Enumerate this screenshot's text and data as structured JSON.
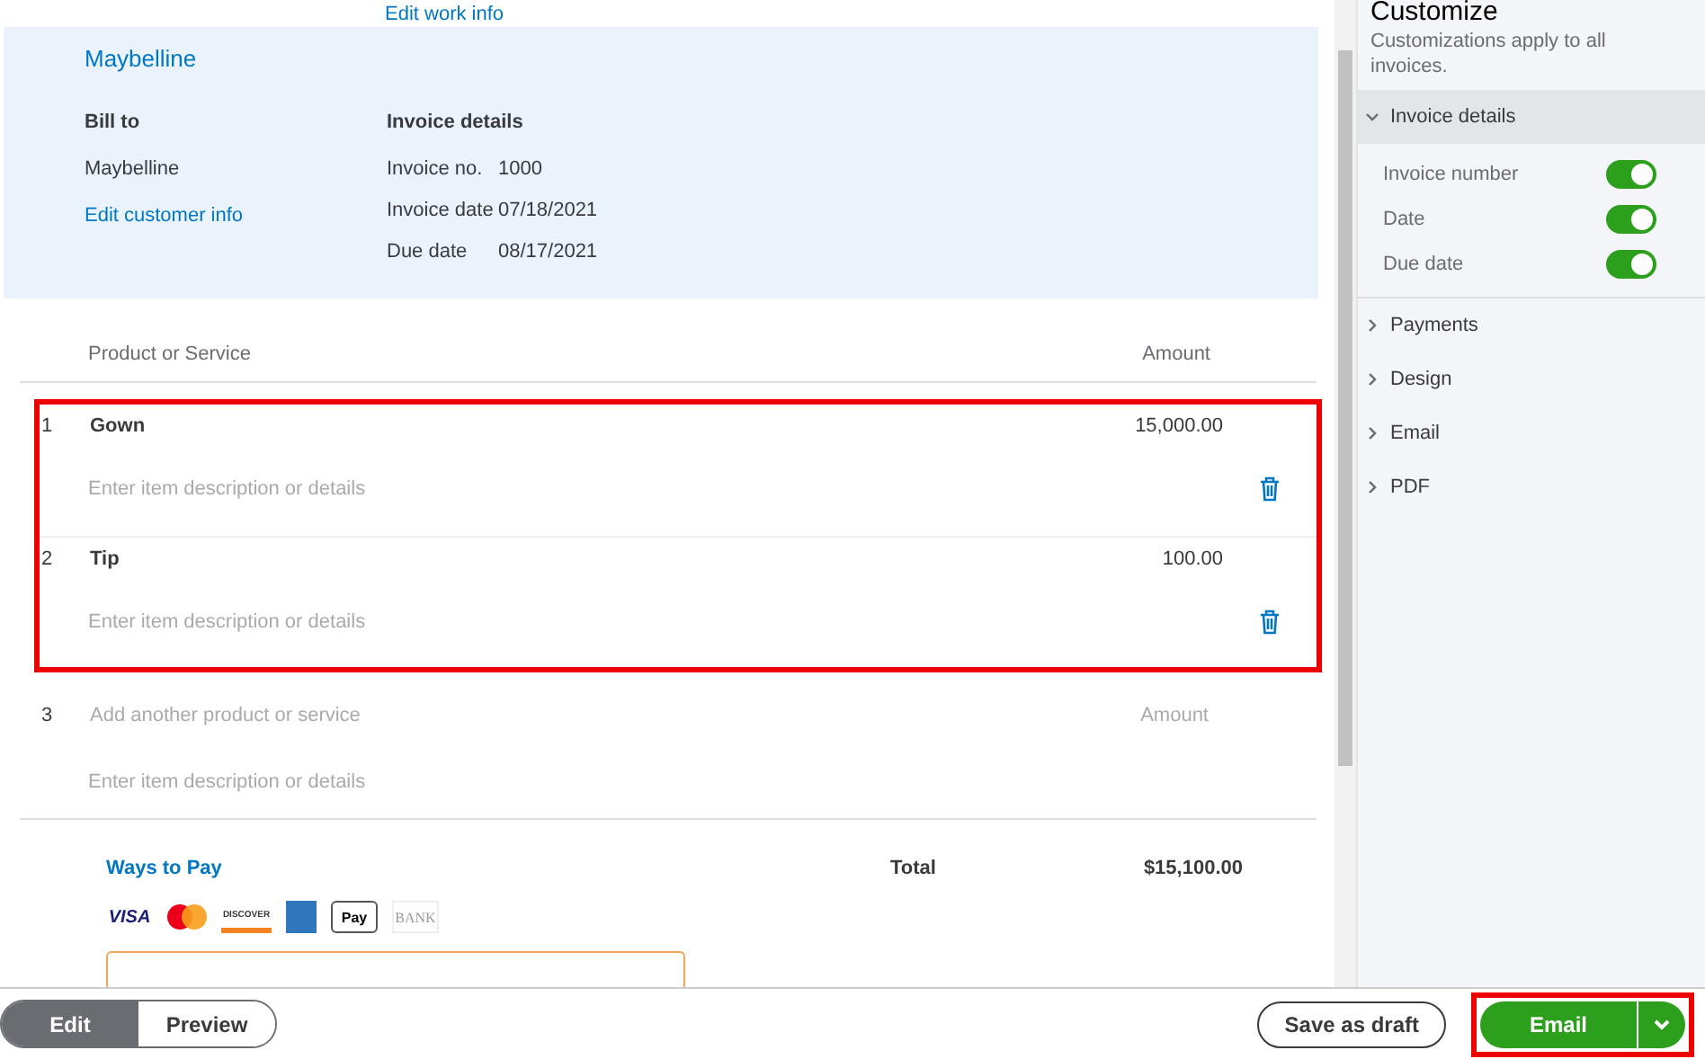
{
  "top_link": "Edit work info",
  "customer": {
    "name": "Maybelline",
    "bill_to_label": "Bill to",
    "bill_to": "Maybelline",
    "edit_link": "Edit customer info"
  },
  "invoice_details": {
    "title": "Invoice details",
    "fields": [
      {
        "label": "Invoice no.",
        "value": "1000"
      },
      {
        "label": "Invoice date",
        "value": "07/18/2021"
      },
      {
        "label": "Due date",
        "value": "08/17/2021"
      }
    ]
  },
  "columns": [
    "Product or Service",
    "Amount"
  ],
  "lines": {
    "highlighted": true,
    "items": [
      {
        "number": "1",
        "product": "Gown",
        "amount": "15,000.00",
        "description_placeholder": "Enter item description or details"
      },
      {
        "number": "2",
        "product": "Tip",
        "amount": "100.00",
        "description_placeholder": "Enter item description or details"
      }
    ]
  },
  "new_line": {
    "number": "3",
    "product_placeholder": "Add another product or service",
    "amount_placeholder": "Amount",
    "description_placeholder": "Enter item description or details"
  },
  "ways_to_pay": {
    "title": "Ways to Pay",
    "methods": [
      {
        "kind": "visa",
        "label": "VISA"
      },
      {
        "kind": "mastercard"
      },
      {
        "kind": "discover",
        "label": "DISCOVER"
      },
      {
        "kind": "amex"
      },
      {
        "kind": "applepay",
        "label": "Pay"
      },
      {
        "kind": "bank",
        "label": "BANK"
      }
    ]
  },
  "total": {
    "label": "Total",
    "value": "$15,100.00"
  },
  "customize": {
    "title": "Customize",
    "subtitle": "Customizations apply to all invoices.",
    "sections": [
      {
        "label": "Invoice details",
        "expanded": true,
        "toggles": [
          {
            "label": "Invoice number",
            "on": true
          },
          {
            "label": "Date",
            "on": true
          },
          {
            "label": "Due date",
            "on": true
          }
        ]
      },
      {
        "label": "Payments",
        "expanded": false
      },
      {
        "label": "Design",
        "expanded": false
      },
      {
        "label": "Email",
        "expanded": false
      },
      {
        "label": "PDF",
        "expanded": false
      }
    ]
  },
  "footer": {
    "view_tabs": [
      {
        "label": "Edit",
        "selected": true
      },
      {
        "label": "Preview",
        "selected": false
      }
    ],
    "save_button": "Save as draft",
    "send_button": {
      "label": "Email",
      "highlighted": true
    }
  }
}
